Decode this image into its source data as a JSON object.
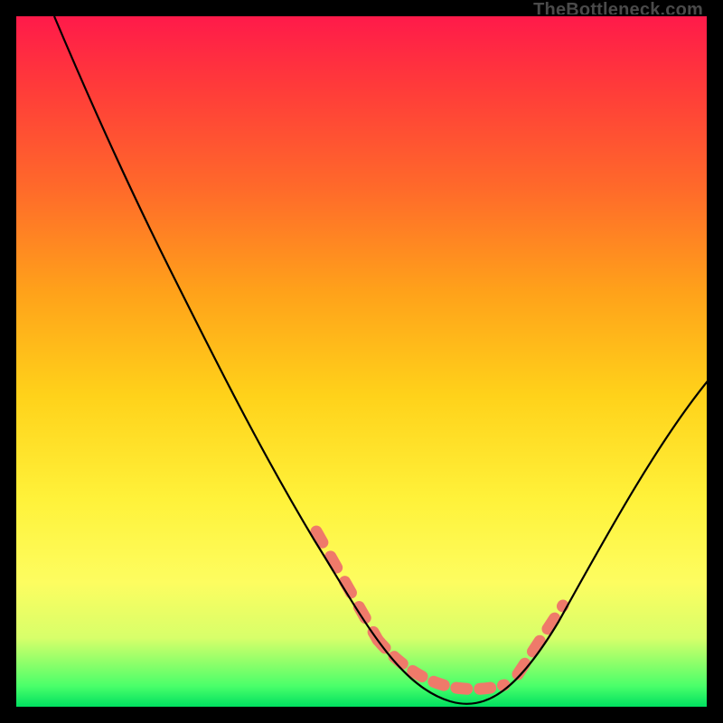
{
  "watermark": "TheBottleneck.com",
  "chart_data": {
    "type": "line",
    "title": "",
    "xlabel": "",
    "ylabel": "",
    "xlim": [
      0,
      100
    ],
    "ylim": [
      0,
      100
    ],
    "grid": false,
    "series": [
      {
        "name": "curve",
        "color": "#000000",
        "x": [
          5,
          10,
          15,
          20,
          25,
          30,
          35,
          40,
          45,
          50,
          55,
          58,
          62,
          66,
          70,
          75,
          80,
          85,
          90,
          95,
          100
        ],
        "values": [
          100,
          92,
          83,
          74,
          64,
          54,
          44,
          34,
          24,
          14,
          6,
          2,
          0,
          0,
          2,
          7,
          14,
          22,
          31,
          40,
          48
        ]
      }
    ],
    "highlight_segments": [
      {
        "name": "left-flank",
        "color": "#ef7a6a",
        "x": [
          40,
          50
        ],
        "y": [
          34,
          14
        ]
      },
      {
        "name": "trough",
        "color": "#ef7a6a",
        "x": [
          53,
          70
        ],
        "y": [
          9,
          2
        ]
      },
      {
        "name": "right-flank",
        "color": "#ef7a6a",
        "x": [
          74,
          80
        ],
        "y": [
          6,
          14
        ]
      }
    ],
    "gradient_stops": [
      {
        "pos": 0,
        "color": "#ff1a4a"
      },
      {
        "pos": 25,
        "color": "#ff6a2a"
      },
      {
        "pos": 55,
        "color": "#ffd21a"
      },
      {
        "pos": 82,
        "color": "#fdfd60"
      },
      {
        "pos": 100,
        "color": "#00e060"
      }
    ]
  }
}
